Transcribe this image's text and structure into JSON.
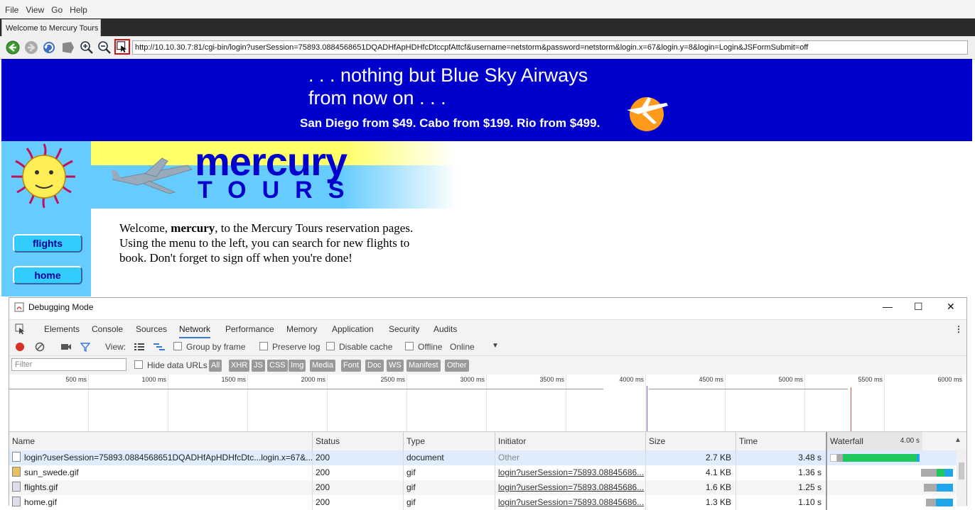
{
  "menu": [
    "File",
    "View",
    "Go",
    "Help"
  ],
  "tab": {
    "title": "Welcome to Mercury Tours"
  },
  "address": {
    "url": "http://10.10.30.7:81/cgi-bin/login?userSession=75893.0884568651DQADHfApHDHfcDtccpfAttcf&username=netstorm&password=netstorm&login.x=67&login.y=8&login=Login&JSFormSubmit=off"
  },
  "banner": {
    "line1": ". . . nothing but Blue Sky Airways",
    "line2": "from now on . . .",
    "subline": "San Diego from $49. Cabo from $199. Rio from $499."
  },
  "logo": {
    "word1": "mercury",
    "word2": "TOURS"
  },
  "nav": {
    "flights": "flights",
    "home": "home"
  },
  "welcome": {
    "prefix": "Welcome, ",
    "user": "mercury",
    "suffix": ", to the Mercury Tours reservation pages. Using the menu to the left, you can search for new flights to book. Don't forget to sign off when you're done!"
  },
  "devtools": {
    "window_title": "Debugging Mode",
    "controls": {
      "minimize": "—",
      "maximize": "☐",
      "close": "✕"
    },
    "tabs": [
      "Elements",
      "Console",
      "Sources",
      "Network",
      "Performance",
      "Memory",
      "Application",
      "Security",
      "Audits"
    ],
    "active_tab": "Network",
    "toolbar": {
      "view_label": "View:",
      "group_by_frame": "Group by frame",
      "preserve_log": "Preserve log",
      "disable_cache": "Disable cache",
      "offline": "Offline",
      "throttle": "Online"
    },
    "filter": {
      "placeholder": "Filter",
      "hide_data_urls": "Hide data URLs",
      "types": [
        "All",
        "XHR",
        "JS",
        "CSS",
        "Img",
        "Media",
        "Font",
        "Doc",
        "WS",
        "Manifest",
        "Other"
      ]
    },
    "timeline_ticks": [
      "500 ms",
      "1000 ms",
      "1500 ms",
      "2000 ms",
      "2500 ms",
      "3000 ms",
      "3500 ms",
      "4000 ms",
      "4500 ms",
      "5000 ms",
      "5500 ms",
      "6000 ms"
    ],
    "columns": {
      "name": "Name",
      "status": "Status",
      "type": "Type",
      "initiator": "Initiator",
      "size": "Size",
      "time": "Time",
      "waterfall": "Waterfall",
      "waterfall_scale": "4.00 s"
    },
    "rows": [
      {
        "name": "login?userSession=75893.0884568651DQADHfApHDHfcDtc...login.x=67&...",
        "status": "200",
        "type": "document",
        "initiator": "Other",
        "size": "2.7 KB",
        "time": "3.48 s"
      },
      {
        "name": "sun_swede.gif",
        "status": "200",
        "type": "gif",
        "initiator": "login?userSession=75893.08845686...",
        "size": "4.1 KB",
        "time": "1.36 s"
      },
      {
        "name": "flights.gif",
        "status": "200",
        "type": "gif",
        "initiator": "login?userSession=75893.08845686...",
        "size": "1.6 KB",
        "time": "1.25 s"
      },
      {
        "name": "home.gif",
        "status": "200",
        "type": "gif",
        "initiator": "login?userSession=75893.08845686...",
        "size": "1.3 KB",
        "time": "1.10 s"
      }
    ]
  },
  "colors": {
    "banner_blue": "#0000cc",
    "sky_blue": "#66ccff",
    "logo_yellow": "#ffff66",
    "record_red": "#d93025",
    "waterfall_green": "#1ec85c",
    "waterfall_blue": "#1ea5ea"
  }
}
